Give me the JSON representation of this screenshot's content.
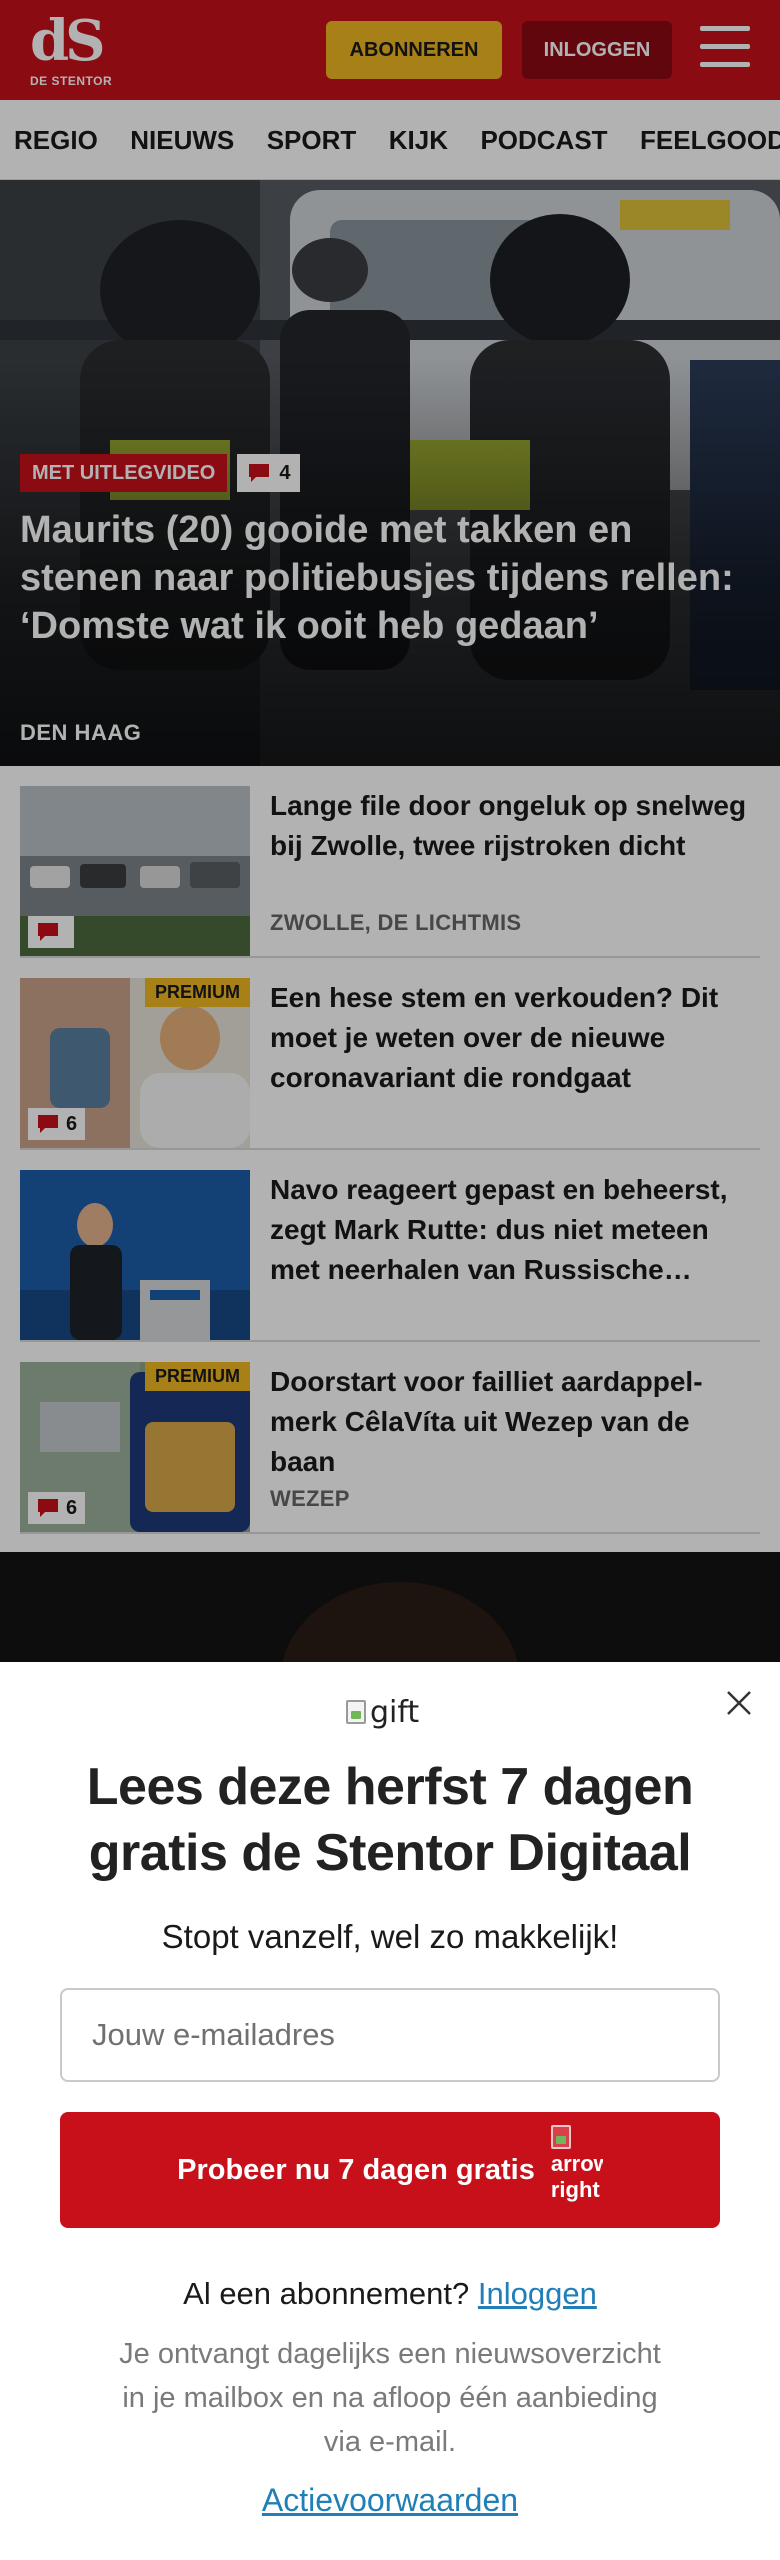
{
  "header": {
    "logo_mark": "dS",
    "logo_name": "DE STENTOR",
    "subscribe_label": "ABONNEREN",
    "login_label": "INLOGGEN",
    "brand_color": "#c8101a",
    "accent_color": "#f0b823"
  },
  "nav": {
    "items": [
      {
        "label": "REGIO"
      },
      {
        "label": "NIEUWS"
      },
      {
        "label": "SPORT"
      },
      {
        "label": "KIJK"
      },
      {
        "label": "PODCAST"
      },
      {
        "label": "FEELGOOD"
      }
    ]
  },
  "hero": {
    "tag_label": "MET UITLEGVIDEO",
    "comment_count": "4",
    "title": "Maurits (20) gooide met takken en stenen naar politiebusjes tijdens rellen: ‘Domste wat ik ooit heb gedaan’",
    "location": "DEN HAAG"
  },
  "articles": [
    {
      "title": "Lange file door ongeluk op snelweg bij Zwolle, twee rijstroken dicht",
      "location": "ZWOLLE, DE LICHTMIS",
      "comment_count": "",
      "premium_label": ""
    },
    {
      "title": "Een hese stem en verkouden? Dit moet je weten over de nieuwe coronavariant die rondgaat",
      "location": "",
      "comment_count": "6",
      "premium_label": "PREMIUM"
    },
    {
      "title": "Navo reageert gepast en beheerst, zegt Mark Rutte: dus niet meteen met neerhalen van Russische toestellen",
      "location": "",
      "comment_count": "",
      "premium_label": ""
    },
    {
      "title": "Doorstart voor failliet aardappel­merk CêlaVíta uit Wezep van de baan",
      "location": "WEZEP",
      "comment_count": "6",
      "premium_label": "PREMIUM"
    }
  ],
  "modal": {
    "gift_alt": "gift",
    "title": "Lees deze herfst 7 dagen gratis de Stentor Digitaal",
    "subtitle": "Stopt vanzelf, wel zo makkelijk!",
    "email_placeholder": "Jouw e-mailadres",
    "cta_label": "Probeer nu 7 dagen gratis",
    "cta_icon_alt": "arrow right",
    "already_text": "Al een abonnement?",
    "already_link": "Inloggen",
    "info": "Je ontvangt dagelijks een nieuwsoverzicht in je mailbox en na afloop één aanbieding via e-mail.",
    "terms_link": "Actievoorwaarden",
    "link_color": "#1f7fb6"
  }
}
